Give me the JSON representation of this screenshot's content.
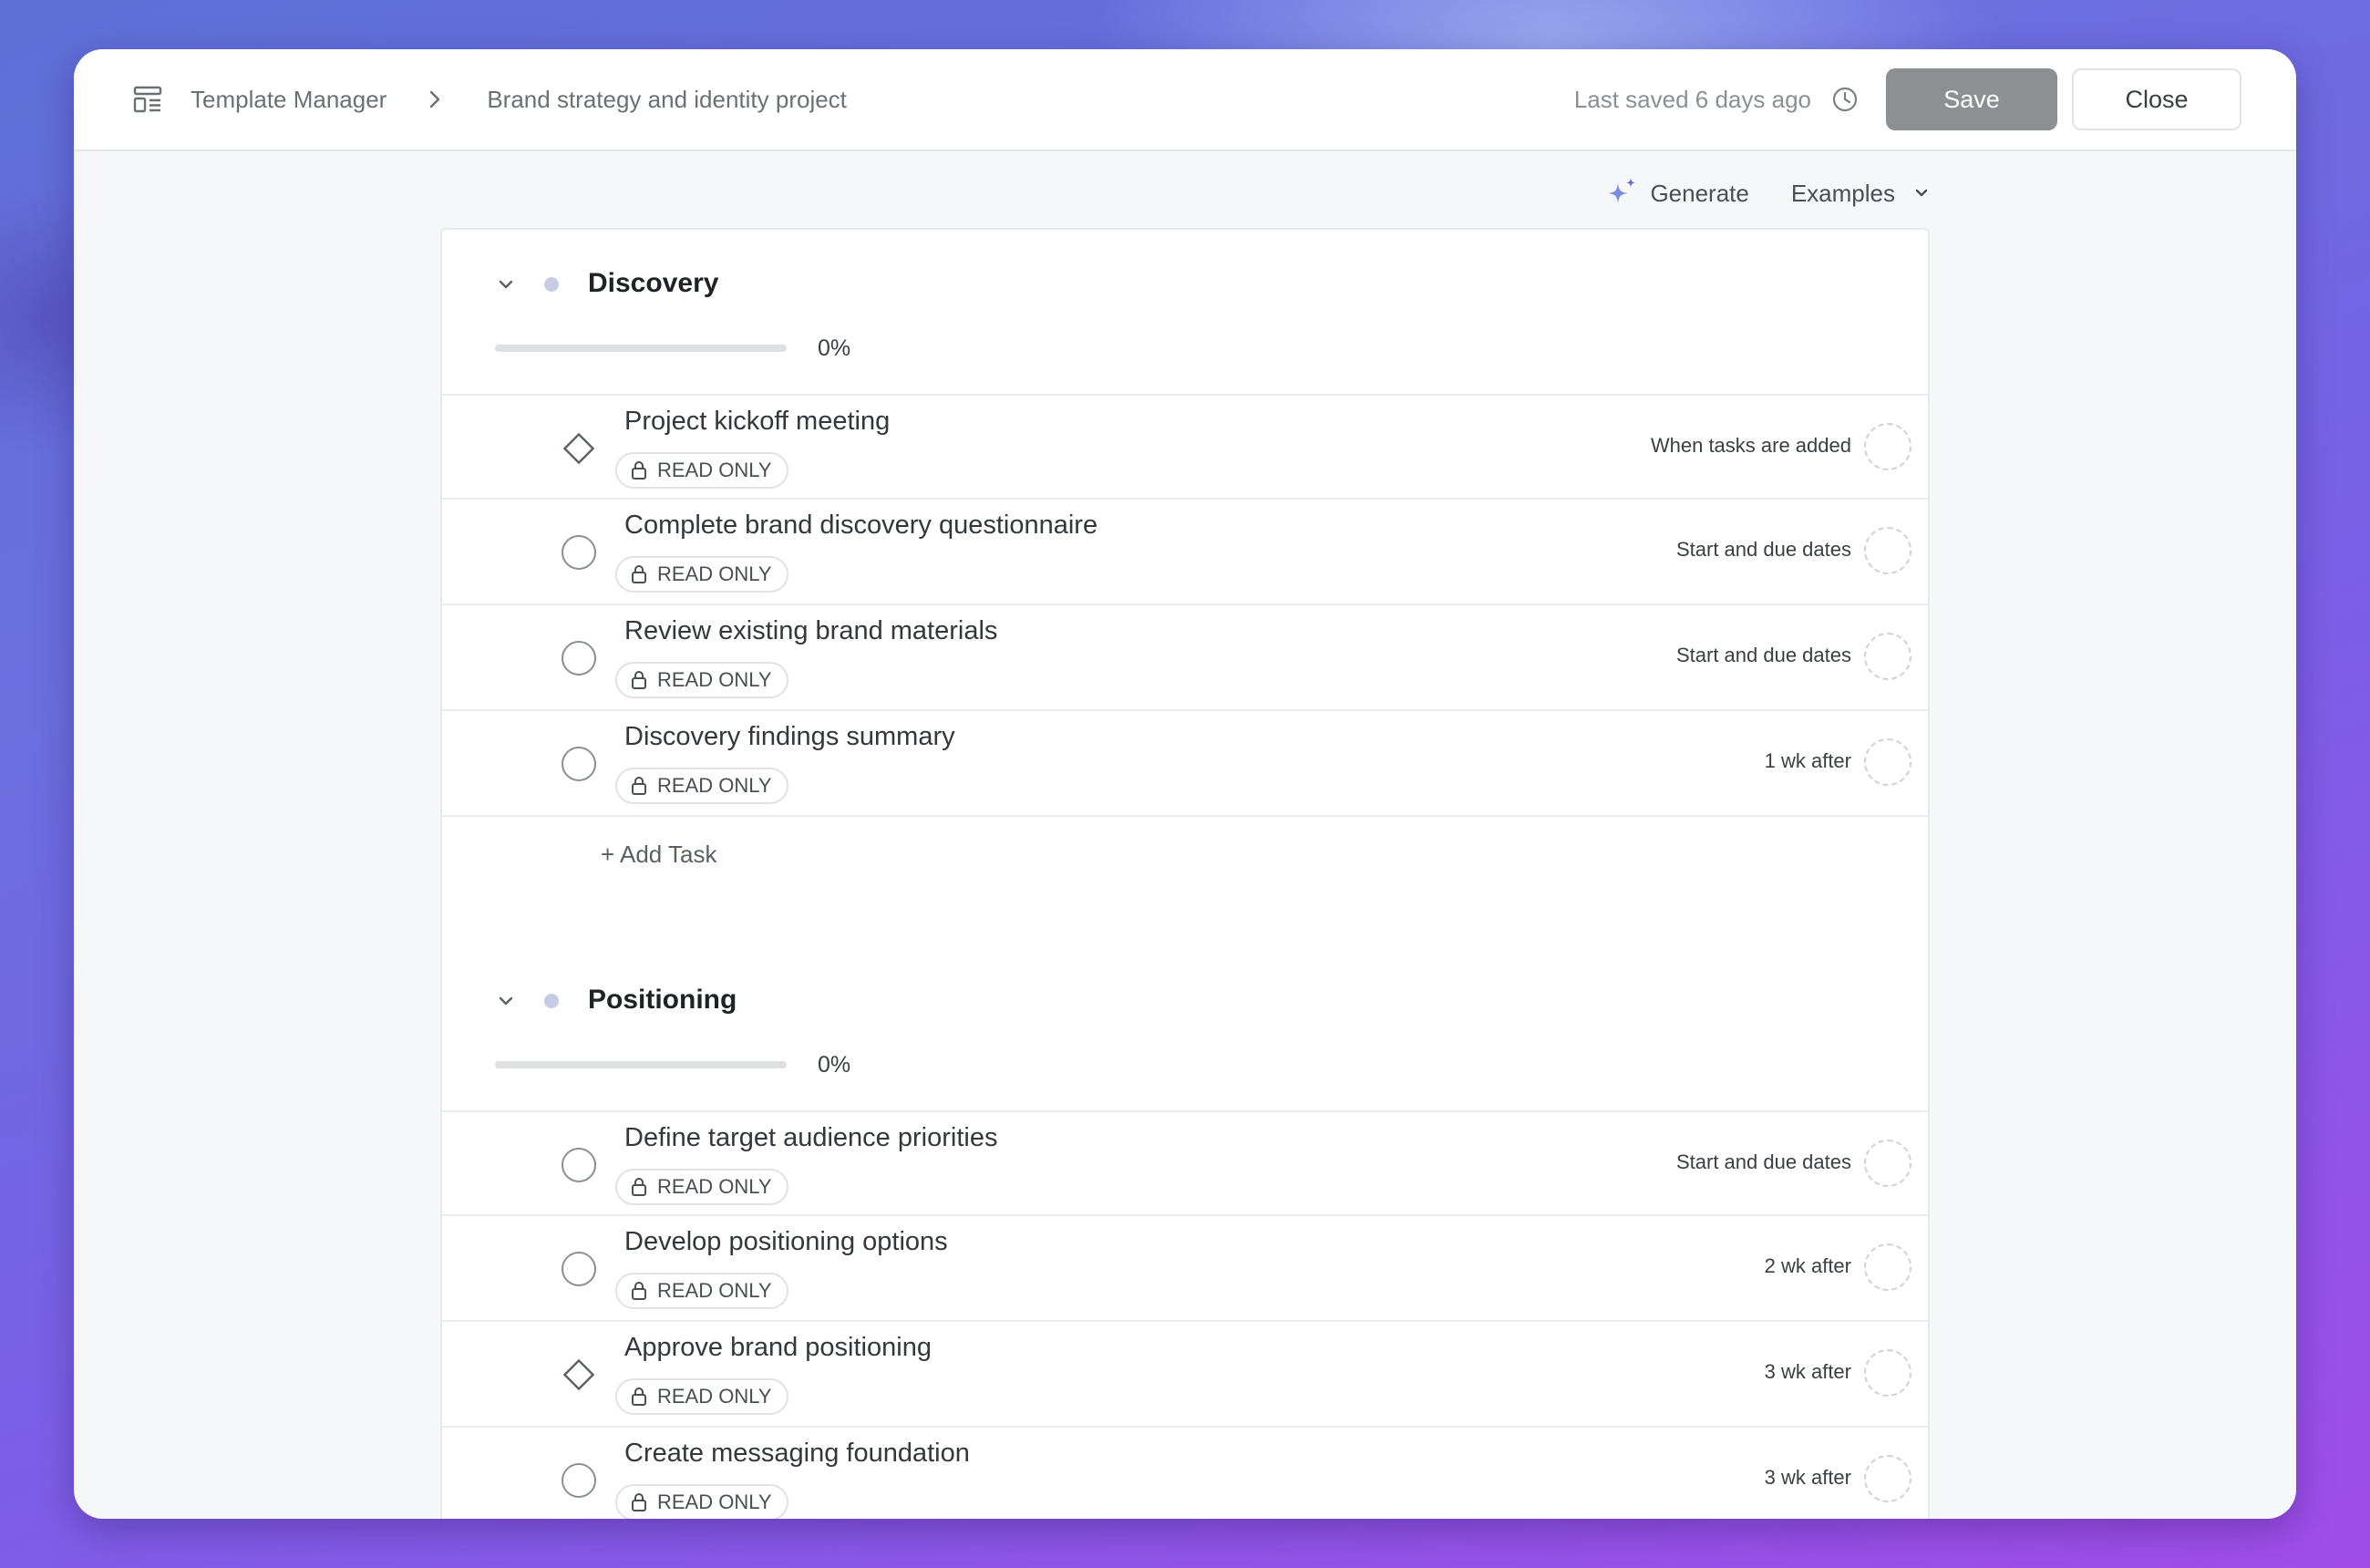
{
  "header": {
    "breadcrumb_root": "Template Manager",
    "breadcrumb_current": "Brand strategy and identity project",
    "saved_status": "Last saved 6 days ago",
    "save_label": "Save",
    "close_label": "Close"
  },
  "toolbar": {
    "generate_label": "Generate",
    "examples_label": "Examples"
  },
  "badge_text": "READ ONLY",
  "add_task_label": "+ Add Task",
  "sections": [
    {
      "title": "Discovery",
      "progress_text": "0%",
      "progress": 0,
      "tasks": [
        {
          "title": "Project kickoff meeting",
          "marker": "diamond",
          "due": "When tasks are added"
        },
        {
          "title": "Complete brand discovery questionnaire",
          "marker": "circle",
          "due": "Start and due dates"
        },
        {
          "title": "Review existing brand materials",
          "marker": "circle",
          "due": "Start and due dates"
        },
        {
          "title": "Discovery findings summary",
          "marker": "circle",
          "due": "1 wk after"
        }
      ]
    },
    {
      "title": "Positioning",
      "progress_text": "0%",
      "progress": 0,
      "tasks": [
        {
          "title": "Define target audience priorities",
          "marker": "circle",
          "due": "Start and due dates"
        },
        {
          "title": "Develop positioning options",
          "marker": "circle",
          "due": "2 wk after"
        },
        {
          "title": "Approve brand positioning",
          "marker": "diamond",
          "due": "3 wk after"
        },
        {
          "title": "Create messaging foundation",
          "marker": "circle",
          "due": "3 wk after"
        }
      ]
    }
  ],
  "colors": {
    "save_button": "#8d8f93",
    "generate_sparkle": "#7b8be0",
    "section_dot": "#c7cbe4"
  }
}
